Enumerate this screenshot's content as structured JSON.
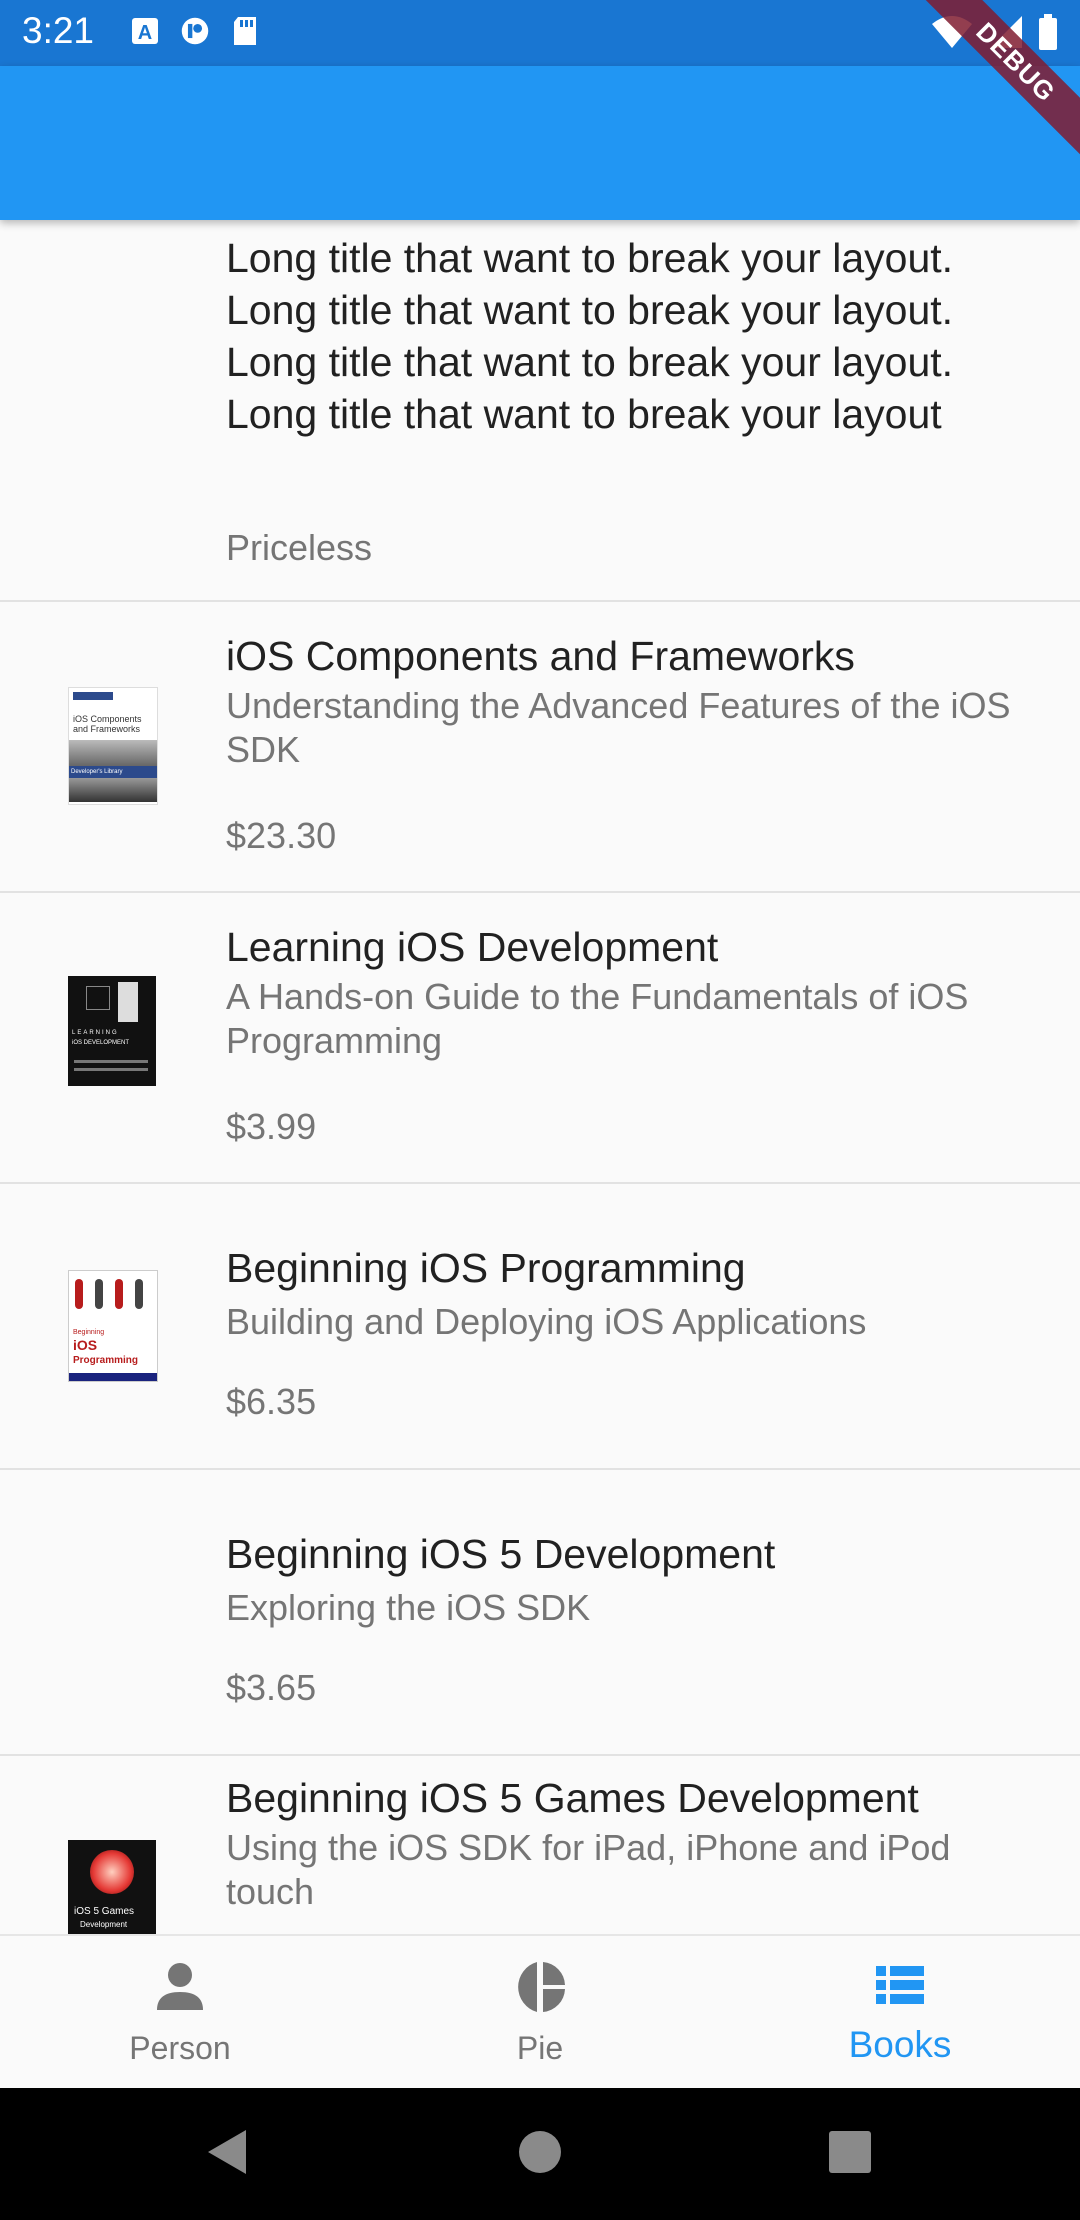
{
  "status_bar": {
    "time": "3:21",
    "left_icons": [
      "a-icon",
      "record-icon",
      "sd-card-icon"
    ],
    "right_icons": [
      "wifi-icon",
      "signal-icon",
      "battery-icon"
    ],
    "background": "#1976d2"
  },
  "app_bar": {
    "background": "#2196f3"
  },
  "debug_banner": {
    "label": "DEBUG"
  },
  "books": [
    {
      "title": "Long title that want to break your layout. Long title that want to break your layout. Long title that want to break your layout. Long title that want to break your layout",
      "subtitle": "",
      "price": "Priceless"
    },
    {
      "title": "iOS Components and Frameworks",
      "subtitle": "Understanding the Advanced Features of the iOS SDK",
      "price": "$23.30",
      "cover_text": [
        "iOS Components",
        "and Frameworks",
        "Developer's Library"
      ]
    },
    {
      "title": "Learning iOS Development",
      "subtitle": "A Hands-on Guide to the Fundamentals of iOS Programming",
      "price": "$3.99",
      "cover_text": [
        "LEARNING",
        "iOS DEVELOPMENT"
      ]
    },
    {
      "title": "Beginning iOS Programming",
      "subtitle": "Building and Deploying iOS Applications",
      "price": "$6.35",
      "cover_text": [
        "Beginning",
        "iOS",
        "Programming"
      ]
    },
    {
      "title": "Beginning iOS 5 Development",
      "subtitle": "Exploring the iOS SDK",
      "price": "$3.65"
    },
    {
      "title": "Beginning iOS 5 Games Development",
      "subtitle": "Using the iOS SDK for iPad, iPhone and iPod touch",
      "price": "",
      "cover_text": [
        "iOS 5 Games",
        "Development"
      ]
    }
  ],
  "bottom_nav": {
    "items": [
      {
        "label": "Person",
        "icon": "person-icon",
        "active": false
      },
      {
        "label": "Pie",
        "icon": "pie-chart-icon",
        "active": false
      },
      {
        "label": "Books",
        "icon": "list-icon",
        "active": true
      }
    ],
    "active_color": "#2196f3",
    "inactive_color": "#757575"
  },
  "system_nav": {
    "buttons": [
      "back-icon",
      "home-icon",
      "recents-icon"
    ]
  }
}
